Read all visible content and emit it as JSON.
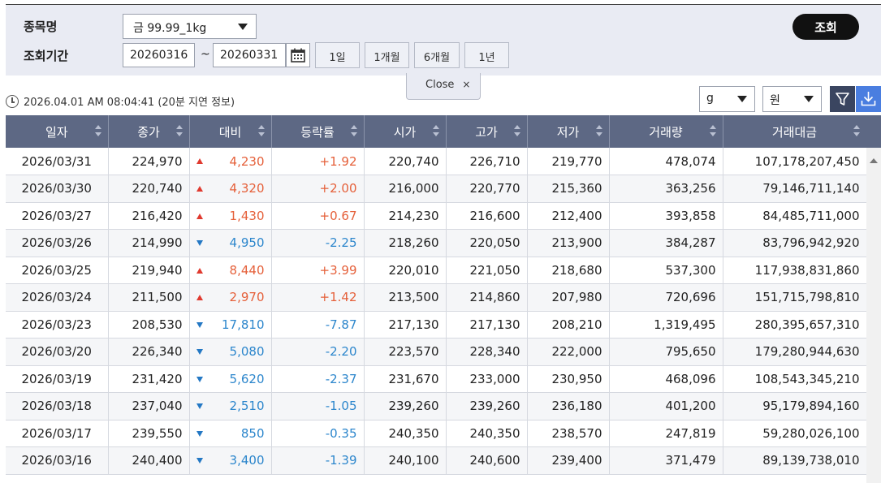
{
  "search": {
    "item_label": "종목명",
    "item_value": "금 99.99_1kg",
    "period_label": "조회기간",
    "date_from": "20260316",
    "date_to": "20260331",
    "period_buttons": [
      "1일",
      "1개월",
      "6개월",
      "1년"
    ],
    "query_button": "조회"
  },
  "close_tab": {
    "label": "Close",
    "x": "×"
  },
  "info": {
    "timestamp": "2026.04.01 AM 08:04:41",
    "delay_note": "(20분 지연 정보)"
  },
  "units": {
    "weight": "g",
    "currency": "원"
  },
  "table": {
    "columns": [
      "일자",
      "종가",
      "대비",
      "등락률",
      "시가",
      "고가",
      "저가",
      "거래량",
      "거래대금"
    ],
    "rows": [
      {
        "date": "2026/03/31",
        "close": "224,970",
        "dir": "up",
        "change": "4,230",
        "rate": "+1.92",
        "open": "220,740",
        "high": "226,710",
        "low": "219,770",
        "volume": "478,074",
        "amount": "107,178,207,450"
      },
      {
        "date": "2026/03/30",
        "close": "220,740",
        "dir": "up",
        "change": "4,320",
        "rate": "+2.00",
        "open": "216,000",
        "high": "220,770",
        "low": "215,360",
        "volume": "363,256",
        "amount": "79,146,711,140"
      },
      {
        "date": "2026/03/27",
        "close": "216,420",
        "dir": "up",
        "change": "1,430",
        "rate": "+0.67",
        "open": "214,230",
        "high": "216,600",
        "low": "212,400",
        "volume": "393,858",
        "amount": "84,485,711,000"
      },
      {
        "date": "2026/03/26",
        "close": "214,990",
        "dir": "down",
        "change": "4,950",
        "rate": "-2.25",
        "open": "218,260",
        "high": "220,050",
        "low": "213,900",
        "volume": "384,287",
        "amount": "83,796,942,920"
      },
      {
        "date": "2026/03/25",
        "close": "219,940",
        "dir": "up",
        "change": "8,440",
        "rate": "+3.99",
        "open": "220,010",
        "high": "221,050",
        "low": "218,680",
        "volume": "537,300",
        "amount": "117,938,831,860"
      },
      {
        "date": "2026/03/24",
        "close": "211,500",
        "dir": "up",
        "change": "2,970",
        "rate": "+1.42",
        "open": "213,500",
        "high": "214,860",
        "low": "207,980",
        "volume": "720,696",
        "amount": "151,715,798,810"
      },
      {
        "date": "2026/03/23",
        "close": "208,530",
        "dir": "down",
        "change": "17,810",
        "rate": "-7.87",
        "open": "217,130",
        "high": "217,130",
        "low": "208,210",
        "volume": "1,319,495",
        "amount": "280,395,657,310"
      },
      {
        "date": "2026/03/20",
        "close": "226,340",
        "dir": "down",
        "change": "5,080",
        "rate": "-2.20",
        "open": "223,570",
        "high": "228,340",
        "low": "222,000",
        "volume": "795,650",
        "amount": "179,280,944,630"
      },
      {
        "date": "2026/03/19",
        "close": "231,420",
        "dir": "down",
        "change": "5,620",
        "rate": "-2.37",
        "open": "231,670",
        "high": "233,000",
        "low": "230,950",
        "volume": "468,096",
        "amount": "108,543,345,210"
      },
      {
        "date": "2026/03/18",
        "close": "237,040",
        "dir": "down",
        "change": "2,510",
        "rate": "-1.05",
        "open": "239,260",
        "high": "239,260",
        "low": "236,180",
        "volume": "401,200",
        "amount": "95,179,894,160"
      },
      {
        "date": "2026/03/17",
        "close": "239,550",
        "dir": "down",
        "change": "850",
        "rate": "-0.35",
        "open": "240,350",
        "high": "240,350",
        "low": "238,570",
        "volume": "247,819",
        "amount": "59,280,026,100"
      },
      {
        "date": "2026/03/16",
        "close": "240,400",
        "dir": "down",
        "change": "3,400",
        "rate": "-1.39",
        "open": "240,100",
        "high": "240,600",
        "low": "239,400",
        "volume": "371,479",
        "amount": "89,139,738,010"
      }
    ]
  },
  "icons": {
    "filter_button": "filter-icon",
    "download_button": "download-icon",
    "calendar_button": "calendar-icon",
    "clock": "clock-icon",
    "up_arrow": "up-triangle",
    "down_arrow": "down-triangle"
  },
  "colors": {
    "header_bg": "#5d6884",
    "panel_bg": "#e9ebf3",
    "up": "#e5603a",
    "down": "#2c86cc",
    "filter_btn": "#3a4560",
    "download_btn": "#4a7ee0"
  }
}
